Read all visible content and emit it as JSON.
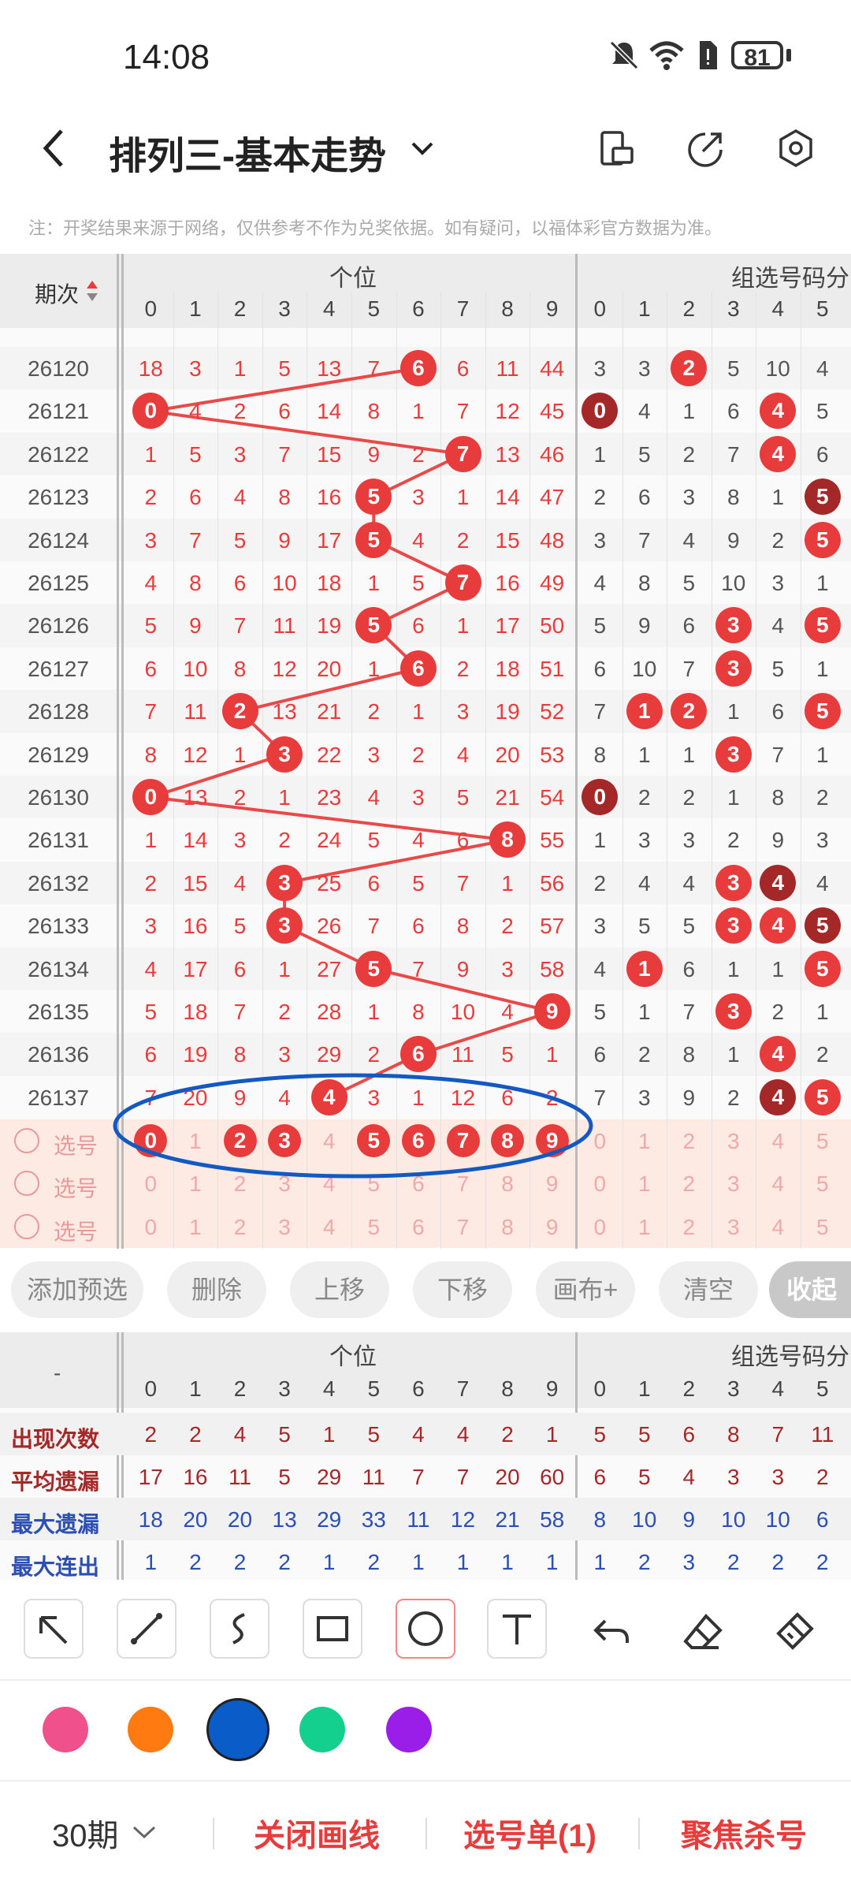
{
  "status_bar": {
    "time": "14:08",
    "battery": "81"
  },
  "header": {
    "title": "排列三-基本走势"
  },
  "notice": "注：开奖结果来源于网络，仅供参考不作为兑奖依据。如有疑问，以福体彩官方数据为准。",
  "table": {
    "period_header": "期次",
    "group_ge": "个位",
    "group_combo": "组选号码分",
    "digits": [
      "0",
      "1",
      "2",
      "3",
      "4",
      "5",
      "6",
      "7",
      "8",
      "9"
    ],
    "combo_digits": [
      "0",
      "1",
      "2",
      "3",
      "4",
      "5"
    ],
    "rows": [
      {
        "period": "26120",
        "vals": [
          "18",
          "3",
          "1",
          "5",
          "13",
          "7",
          "6",
          "6",
          "11",
          "44"
        ],
        "win": 6,
        "combo": [
          "3",
          "3",
          "2",
          "5",
          "10",
          "4"
        ],
        "combo_balls": [
          2
        ]
      },
      {
        "period": "26121",
        "vals": [
          "0",
          "4",
          "2",
          "6",
          "14",
          "8",
          "1",
          "7",
          "12",
          "45"
        ],
        "win": 0,
        "combo": [
          "0",
          "4",
          "1",
          "6",
          "4",
          "5"
        ],
        "combo_balls": [
          0,
          4
        ]
      },
      {
        "period": "26122",
        "vals": [
          "1",
          "5",
          "3",
          "7",
          "15",
          "9",
          "2",
          "7",
          "13",
          "46"
        ],
        "win": 7,
        "combo": [
          "1",
          "5",
          "2",
          "7",
          "4",
          "6"
        ],
        "combo_balls": [
          4
        ]
      },
      {
        "period": "26123",
        "vals": [
          "2",
          "6",
          "4",
          "8",
          "16",
          "5",
          "3",
          "1",
          "14",
          "47"
        ],
        "win": 5,
        "combo": [
          "2",
          "6",
          "3",
          "8",
          "1",
          "5"
        ],
        "combo_balls": [
          5
        ]
      },
      {
        "period": "26124",
        "vals": [
          "3",
          "7",
          "5",
          "9",
          "17",
          "5",
          "4",
          "2",
          "15",
          "48"
        ],
        "win": 5,
        "combo": [
          "3",
          "7",
          "4",
          "9",
          "2",
          "5"
        ],
        "combo_balls": [
          5
        ]
      },
      {
        "period": "26125",
        "vals": [
          "4",
          "8",
          "6",
          "10",
          "18",
          "1",
          "5",
          "7",
          "16",
          "49"
        ],
        "win": 7,
        "combo": [
          "4",
          "8",
          "5",
          "10",
          "3",
          "1"
        ],
        "combo_balls": []
      },
      {
        "period": "26126",
        "vals": [
          "5",
          "9",
          "7",
          "11",
          "19",
          "5",
          "6",
          "1",
          "17",
          "50"
        ],
        "win": 5,
        "combo": [
          "5",
          "9",
          "6",
          "3",
          "4",
          "5"
        ],
        "combo_balls": [
          3,
          5
        ]
      },
      {
        "period": "26127",
        "vals": [
          "6",
          "10",
          "8",
          "12",
          "20",
          "1",
          "6",
          "2",
          "18",
          "51"
        ],
        "win": 6,
        "combo": [
          "6",
          "10",
          "7",
          "3",
          "5",
          "1"
        ],
        "combo_balls": [
          3
        ]
      },
      {
        "period": "26128",
        "vals": [
          "7",
          "11",
          "2",
          "13",
          "21",
          "2",
          "1",
          "3",
          "19",
          "52"
        ],
        "win": 2,
        "combo": [
          "7",
          "1",
          "2",
          "1",
          "6",
          "5"
        ],
        "combo_balls": [
          1,
          2,
          5
        ]
      },
      {
        "period": "26129",
        "vals": [
          "8",
          "12",
          "1",
          "3",
          "22",
          "3",
          "2",
          "4",
          "20",
          "53"
        ],
        "win": 3,
        "combo": [
          "8",
          "1",
          "1",
          "3",
          "7",
          "1"
        ],
        "combo_balls": [
          3
        ]
      },
      {
        "period": "26130",
        "vals": [
          "0",
          "13",
          "2",
          "1",
          "23",
          "4",
          "3",
          "5",
          "21",
          "54"
        ],
        "win": 0,
        "combo": [
          "0",
          "2",
          "2",
          "1",
          "8",
          "2"
        ],
        "combo_balls": [
          0
        ]
      },
      {
        "period": "26131",
        "vals": [
          "1",
          "14",
          "3",
          "2",
          "24",
          "5",
          "4",
          "6",
          "8",
          "55"
        ],
        "win": 8,
        "combo": [
          "1",
          "3",
          "3",
          "2",
          "9",
          "3"
        ],
        "combo_balls": []
      },
      {
        "period": "26132",
        "vals": [
          "2",
          "15",
          "4",
          "3",
          "25",
          "6",
          "5",
          "7",
          "1",
          "56"
        ],
        "win": 3,
        "combo": [
          "2",
          "4",
          "4",
          "3",
          "4",
          "4"
        ],
        "combo_balls": [
          3,
          4
        ]
      },
      {
        "period": "26133",
        "vals": [
          "3",
          "16",
          "5",
          "3",
          "26",
          "7",
          "6",
          "8",
          "2",
          "57"
        ],
        "win": 3,
        "combo": [
          "3",
          "5",
          "5",
          "3",
          "4",
          "5"
        ],
        "combo_balls": [
          3,
          4,
          5
        ]
      },
      {
        "period": "26134",
        "vals": [
          "4",
          "17",
          "6",
          "1",
          "27",
          "5",
          "7",
          "9",
          "3",
          "58"
        ],
        "win": 5,
        "combo": [
          "4",
          "1",
          "6",
          "1",
          "1",
          "5"
        ],
        "combo_balls": [
          1,
          5
        ]
      },
      {
        "period": "26135",
        "vals": [
          "5",
          "18",
          "7",
          "2",
          "28",
          "1",
          "8",
          "10",
          "4",
          "9"
        ],
        "win": 9,
        "combo": [
          "5",
          "1",
          "7",
          "3",
          "2",
          "1"
        ],
        "combo_balls": [
          3
        ]
      },
      {
        "period": "26136",
        "vals": [
          "6",
          "19",
          "8",
          "3",
          "29",
          "2",
          "6",
          "11",
          "5",
          "1"
        ],
        "win": 6,
        "combo": [
          "6",
          "2",
          "8",
          "1",
          "4",
          "2"
        ],
        "combo_balls": [
          4
        ]
      },
      {
        "period": "26137",
        "vals": [
          "7",
          "20",
          "9",
          "4",
          "4",
          "3",
          "1",
          "12",
          "6",
          "2"
        ],
        "win": 4,
        "combo": [
          "7",
          "3",
          "9",
          "2",
          "4",
          "5"
        ],
        "combo_balls": [
          4,
          5
        ]
      }
    ],
    "pick_label": "选号",
    "pick_selected": [
      0,
      2,
      3,
      5,
      6,
      7,
      8,
      9
    ]
  },
  "buttons": [
    "添加预选",
    "删除",
    "上移",
    "下移",
    "画布+",
    "清空",
    "收起"
  ],
  "stats": {
    "dash": "-",
    "rows": [
      {
        "label": "出现次数",
        "vals": [
          "2",
          "2",
          "4",
          "5",
          "1",
          "5",
          "4",
          "4",
          "2",
          "1",
          "5",
          "5",
          "6",
          "8",
          "7",
          "11"
        ],
        "color": "#a52828"
      },
      {
        "label": "平均遗漏",
        "vals": [
          "17",
          "16",
          "11",
          "5",
          "29",
          "11",
          "7",
          "7",
          "20",
          "60",
          "6",
          "5",
          "4",
          "3",
          "3",
          "2"
        ],
        "color": "#a52828"
      },
      {
        "label": "最大遗漏",
        "vals": [
          "18",
          "20",
          "20",
          "13",
          "29",
          "33",
          "11",
          "12",
          "21",
          "58",
          "8",
          "10",
          "9",
          "10",
          "10",
          "6"
        ],
        "color": "#2b4fb3"
      },
      {
        "label": "最大连出",
        "vals": [
          "1",
          "2",
          "2",
          "2",
          "1",
          "2",
          "1",
          "1",
          "1",
          "1",
          "1",
          "2",
          "3",
          "2",
          "2",
          "2"
        ],
        "color": "#2b4fb3"
      }
    ]
  },
  "palette": [
    "#f0508c",
    "#ff7a10",
    "#0a5cc8",
    "#14d08e",
    "#9a1ee8"
  ],
  "bottom": {
    "periods": "30期",
    "close": "关闭画线",
    "picklist": "选号单(1)",
    "focus": "聚焦杀号"
  }
}
